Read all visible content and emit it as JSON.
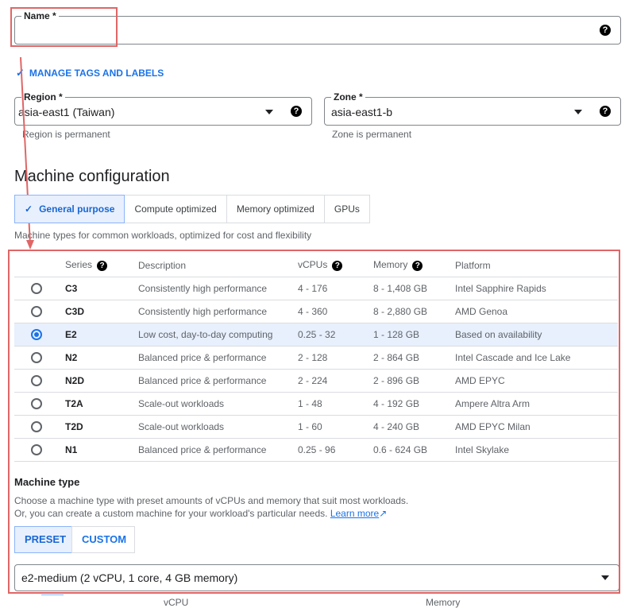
{
  "name_field": {
    "label": "Name *",
    "value": ""
  },
  "manage_tags": {
    "label": "MANAGE TAGS AND LABELS"
  },
  "region": {
    "label": "Region *",
    "value": "asia-east1 (Taiwan)",
    "hint": "Region is permanent"
  },
  "zone": {
    "label": "Zone *",
    "value": "asia-east1-b",
    "hint": "Zone is permanent"
  },
  "machine_config": {
    "title": "Machine configuration",
    "tabs": [
      {
        "label": "General purpose"
      },
      {
        "label": "Compute optimized"
      },
      {
        "label": "Memory optimized"
      },
      {
        "label": "GPUs"
      }
    ],
    "description": "Machine types for common workloads, optimized for cost and flexibility"
  },
  "table": {
    "headers": {
      "series": "Series",
      "description": "Description",
      "vcpus": "vCPUs",
      "memory": "Memory",
      "platform": "Platform"
    },
    "rows": [
      {
        "series": "C3",
        "description": "Consistently high performance",
        "vcpus": "4 - 176",
        "memory": "8 - 1,408 GB",
        "platform": "Intel Sapphire Rapids"
      },
      {
        "series": "C3D",
        "description": "Consistently high performance",
        "vcpus": "4 - 360",
        "memory": "8 - 2,880 GB",
        "platform": "AMD Genoa"
      },
      {
        "series": "E2",
        "description": "Low cost, day-to-day computing",
        "vcpus": "0.25 - 32",
        "memory": "1 - 128 GB",
        "platform": "Based on availability"
      },
      {
        "series": "N2",
        "description": "Balanced price & performance",
        "vcpus": "2 - 128",
        "memory": "2 - 864 GB",
        "platform": "Intel Cascade and Ice Lake"
      },
      {
        "series": "N2D",
        "description": "Balanced price & performance",
        "vcpus": "2 - 224",
        "memory": "2 - 896 GB",
        "platform": "AMD EPYC"
      },
      {
        "series": "T2A",
        "description": "Scale-out workloads",
        "vcpus": "1 - 48",
        "memory": "4 - 192 GB",
        "platform": "Ampere Altra Arm"
      },
      {
        "series": "T2D",
        "description": "Scale-out workloads",
        "vcpus": "1 - 60",
        "memory": "4 - 240 GB",
        "platform": "AMD EPYC Milan"
      },
      {
        "series": "N1",
        "description": "Balanced price & performance",
        "vcpus": "0.25 - 96",
        "memory": "0.6 - 624 GB",
        "platform": "Intel Skylake"
      }
    ],
    "selected_series": "E2"
  },
  "machine_type": {
    "title": "Machine type",
    "desc1": "Choose a machine type with preset amounts of vCPUs and memory that suit most workloads.",
    "desc2": "Or, you can create a custom machine for your workload's particular needs.",
    "learn_more": "Learn more",
    "preset_label": "PRESET",
    "custom_label": "CUSTOM",
    "selected_value": "e2-medium (2 vCPU, 1 core, 4 GB memory)",
    "footer_vcpu": "vCPU",
    "footer_memory": "Memory"
  },
  "colors": {
    "accent": "#1a73e8",
    "annotation": "#e06666",
    "selected_bg": "#e8f0fe"
  }
}
